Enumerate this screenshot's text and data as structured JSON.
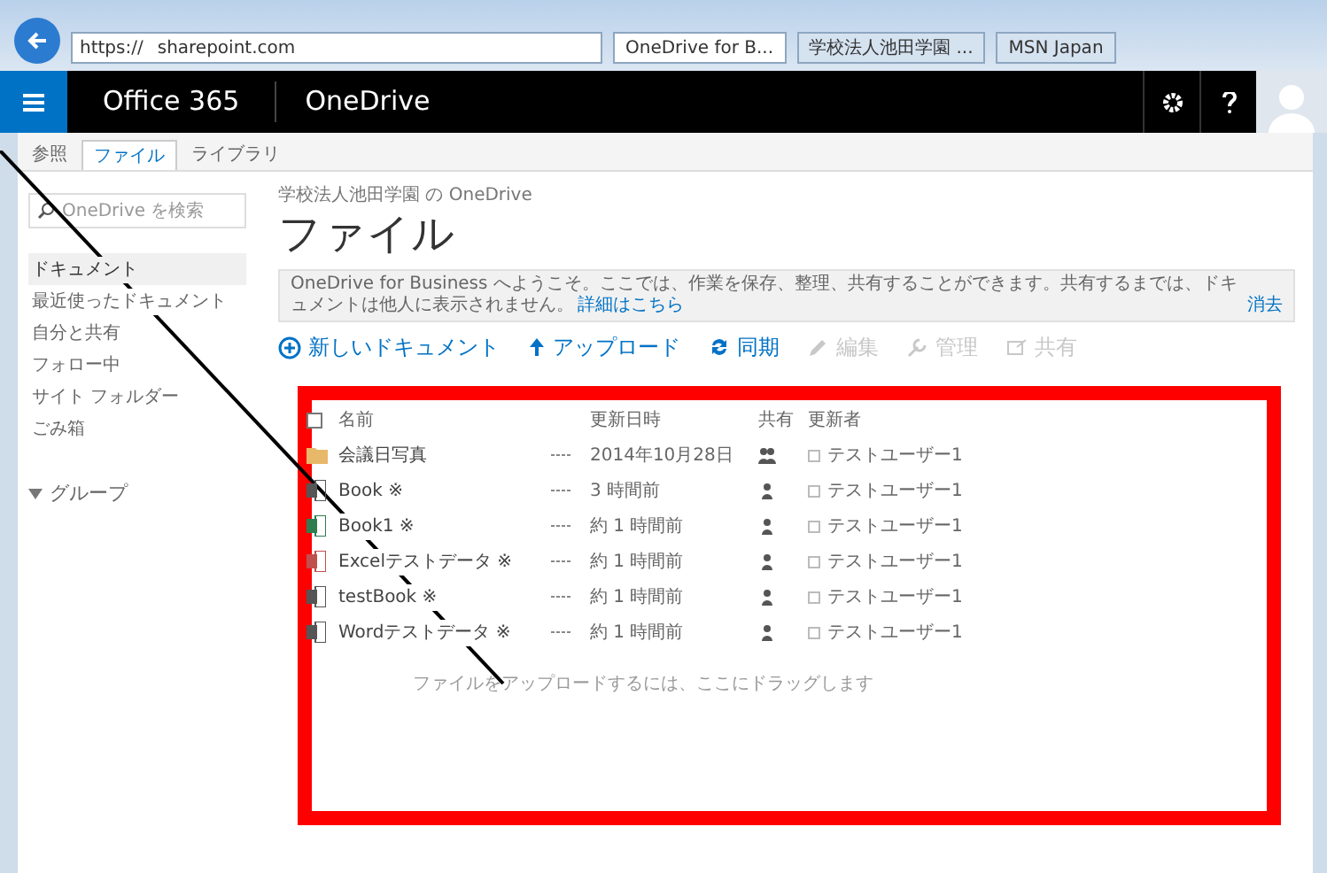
{
  "browser": {
    "address": "https://",
    "domain": "sharepoint.com",
    "tabs": [
      {
        "label": "OneDrive for B...",
        "selected": true
      },
      {
        "label": "学校法人池田学園 ...",
        "selected": false
      },
      {
        "label": "MSN Japan",
        "selected": false
      }
    ]
  },
  "suite_bar": {
    "brand": "Office 365",
    "app": "OneDrive"
  },
  "ribbon_tabs": [
    {
      "label": "参照",
      "selected": false
    },
    {
      "label": "ファイル",
      "selected": true
    },
    {
      "label": "ライブラリ",
      "selected": false
    }
  ],
  "sidebar": {
    "search_placeholder": "OneDrive を検索",
    "items": [
      {
        "label": "ドキュメント",
        "selected": true
      },
      {
        "label": "最近使ったドキュメント",
        "selected": false
      },
      {
        "label": "自分と共有",
        "selected": false
      },
      {
        "label": "フォロー中",
        "selected": false
      },
      {
        "label": "サイト フォルダー",
        "selected": false
      },
      {
        "label": "ごみ箱",
        "selected": false
      }
    ],
    "group": "グループ"
  },
  "breadcrumb": "学校法人池田学園 の OneDrive",
  "title": "ファイル",
  "banner": {
    "text": "OneDrive for Business へようこそ。ここでは、作業を保存、整理、共有することができます。共有するまでは、ドキュメントは他人に表示されません。",
    "link": "詳細はこちら",
    "dismiss": "消去"
  },
  "toolbar": [
    {
      "label": "新しいドキュメント",
      "kind": "new",
      "disabled": false
    },
    {
      "label": "アップロード",
      "kind": "upload",
      "disabled": false
    },
    {
      "label": "同期",
      "kind": "sync",
      "disabled": false
    },
    {
      "label": "編集",
      "kind": "edit",
      "disabled": true
    },
    {
      "label": "管理",
      "kind": "manage",
      "disabled": true
    },
    {
      "label": "共有",
      "kind": "share",
      "disabled": true
    }
  ],
  "table": {
    "select_all_checked": false,
    "columns": [
      "名前",
      "更新日時",
      "共有",
      "更新者"
    ],
    "rows": [
      {
        "name": "会議日写真",
        "kind": "folder",
        "color": "#e8b86a",
        "modified": "2014年10月28日",
        "shared": true,
        "modified_by": "テストユーザー1"
      },
      {
        "name": "Book ※",
        "kind": "doc",
        "color": "#555555",
        "modified": "3 時間前",
        "shared": false,
        "modified_by": "テストユーザー1"
      },
      {
        "name": "Book1 ※",
        "kind": "doc",
        "color": "#2e7d4f",
        "modified": "約 1 時間前",
        "shared": false,
        "modified_by": "テストユーザー1"
      },
      {
        "name": "Excelテストデータ ※",
        "kind": "doc",
        "color": "#c0504d",
        "modified": "約 1 時間前",
        "shared": false,
        "modified_by": "テストユーザー1"
      },
      {
        "name": "testBook ※",
        "kind": "doc",
        "color": "#555555",
        "modified": "約 1 時間前",
        "shared": false,
        "modified_by": "テストユーザー1"
      },
      {
        "name": "Wordテストデータ ※",
        "kind": "doc",
        "color": "#555555",
        "modified": "約 1 時間前",
        "shared": false,
        "modified_by": "テストユーザー1"
      }
    ],
    "drop_hint": "ファイルをアップロードするには、ここにドラッグします"
  }
}
